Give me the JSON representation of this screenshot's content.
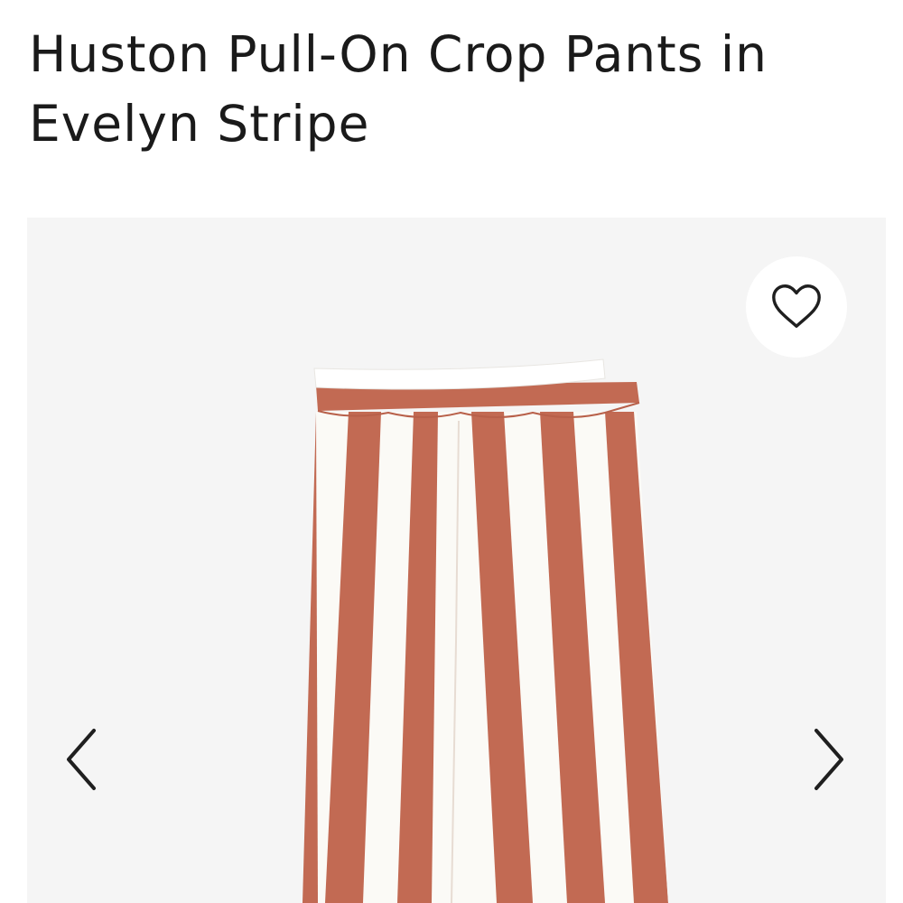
{
  "product": {
    "title": "Huston Pull-On Crop Pants in Evelyn Stripe"
  },
  "gallery": {
    "image_subject": "striped crop pants",
    "favorite_icon": "heart-outline-icon",
    "prev_icon": "chevron-left-icon",
    "next_icon": "chevron-right-icon"
  },
  "colors": {
    "background": "#ffffff",
    "gallery_background": "#f5f5f5",
    "stripe_rust": "#c26a53",
    "stripe_white": "#fbfaf6",
    "icon": "#1f1f1f"
  }
}
